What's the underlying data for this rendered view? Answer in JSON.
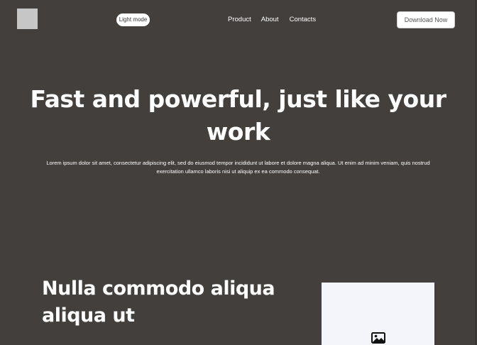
{
  "header": {
    "mode_toggle": "Light mode",
    "nav": [
      "Product",
      "About",
      "Contacts"
    ],
    "download_button": "Download Now"
  },
  "hero": {
    "title": "Fast and powerful, just like your work",
    "text": "Lorem ipsum dolor sit amet, consectetur adipiscing elit, sed do eiusmod tempor incididunt ut labore et dolore magna aliqua. Ut enim ad minim veniam, quis nostrud exercitation ullamco laboris nisi ut aliquip ex ea commodo consequat."
  },
  "section": {
    "title": "Nulla commodo aliqua aliqua ut",
    "image_icon": "image-icon"
  },
  "colors": {
    "background": "#433f3d",
    "text": "#ffffff",
    "logo_placeholder": "#c6c6c6",
    "image_placeholder": "#f4f4fb"
  }
}
